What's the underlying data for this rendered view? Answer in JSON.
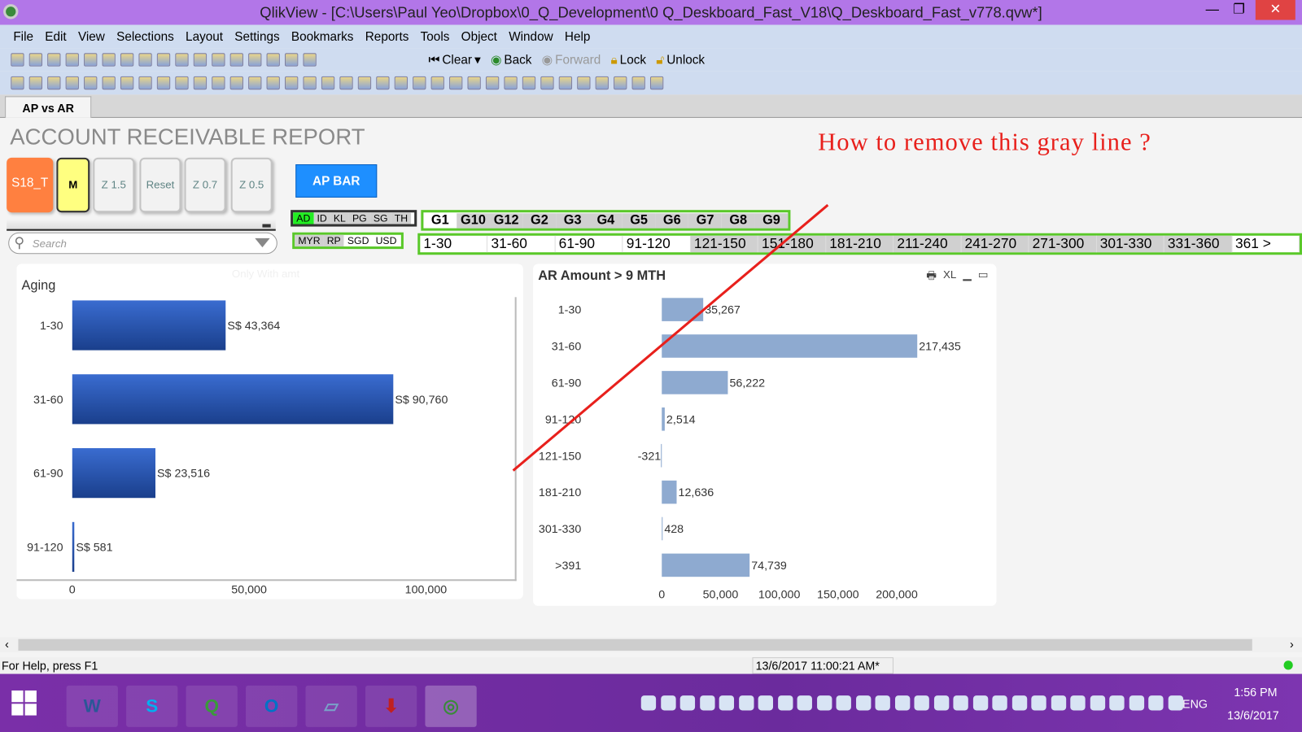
{
  "window": {
    "title": "QlikView - [C:\\Users\\Paul Yeo\\Dropbox\\0_Q_Development\\0 Q_Deskboard_Fast_V18\\Q_Deskboard_Fast_v778.qvw*]",
    "minimize": "—",
    "restore": "❐",
    "close": "✕"
  },
  "menu": [
    "File",
    "Edit",
    "View",
    "Selections",
    "Layout",
    "Settings",
    "Bookmarks",
    "Reports",
    "Tools",
    "Object",
    "Window",
    "Help"
  ],
  "toolbar": {
    "clear": "Clear",
    "back": "Back",
    "forward": "Forward",
    "lock": "Lock",
    "unlock": "Unlock"
  },
  "sheet_tab": "AP vs AR",
  "report_title": "ACCOUNT RECEIVABLE REPORT",
  "annotation": "How to remove this gray line ?",
  "annotation_color": "#e8201c",
  "buttons": [
    {
      "label": "S18_T",
      "color": "#ff8040"
    },
    {
      "label": "M",
      "color": "#ffff80"
    },
    {
      "label": "Z 1.5"
    },
    {
      "label": "Reset"
    },
    {
      "label": "Z 0.7"
    },
    {
      "label": "Z 0.5"
    }
  ],
  "ap_bar": "AP BAR",
  "search_placeholder": "Search",
  "regions": [
    "AD",
    "ID",
    "KL",
    "PG",
    "SG",
    "TH"
  ],
  "region_selected": "AD",
  "currencies": [
    "MYR",
    "RP",
    "SGD",
    "USD"
  ],
  "groups": [
    "G1",
    "G10",
    "G12",
    "G2",
    "G3",
    "G4",
    "G5",
    "G6",
    "G7",
    "G8",
    "G9"
  ],
  "aging_list": [
    "1-30",
    "31-60",
    "61-90",
    "91-120",
    "121-150",
    "151-180",
    "181-210",
    "211-240",
    "241-270",
    "271-300",
    "301-330",
    "331-360",
    "361 >"
  ],
  "chart_data": [
    {
      "type": "bar",
      "orientation": "horizontal",
      "title": "Only With amt",
      "ylabel": "Aging",
      "categories": [
        "1-30",
        "31-60",
        "61-90",
        "91-120"
      ],
      "values": [
        43364,
        90760,
        23516,
        581
      ],
      "labels": [
        "S$ 43,364",
        "S$ 90,760",
        "S$ 23,516",
        "S$ 581"
      ],
      "xticks": [
        "0",
        "50,000",
        "100,000"
      ],
      "xlim": [
        0,
        125000
      ],
      "color": "#1f4faa"
    },
    {
      "type": "bar",
      "orientation": "horizontal",
      "title": "AR Amount > 9 MTH",
      "categories": [
        "1-30",
        "31-60",
        "61-90",
        "91-120",
        "121-150",
        "181-210",
        "301-330",
        ">391"
      ],
      "values": [
        35267,
        217435,
        56222,
        2514,
        -321,
        12636,
        428,
        74739
      ],
      "labels": [
        "35,267",
        "217,435",
        "56,222",
        "2,514",
        "-321",
        "12,636",
        "428",
        "74,739"
      ],
      "xticks": [
        "0",
        "50,000",
        "100,000",
        "150,000",
        "200,000"
      ],
      "xlim": [
        0,
        250000
      ],
      "color": "#8eaad0",
      "header_icons": {
        "print": "🖶",
        "xl": "XL",
        "min": "▁",
        "max": "▭"
      }
    }
  ],
  "status": {
    "help": "For Help, press F1",
    "timestamp": "13/6/2017 11:00:21 AM*"
  },
  "taskbar": {
    "lang": "ENG",
    "time": "1:56 PM",
    "date": "13/6/2017"
  }
}
